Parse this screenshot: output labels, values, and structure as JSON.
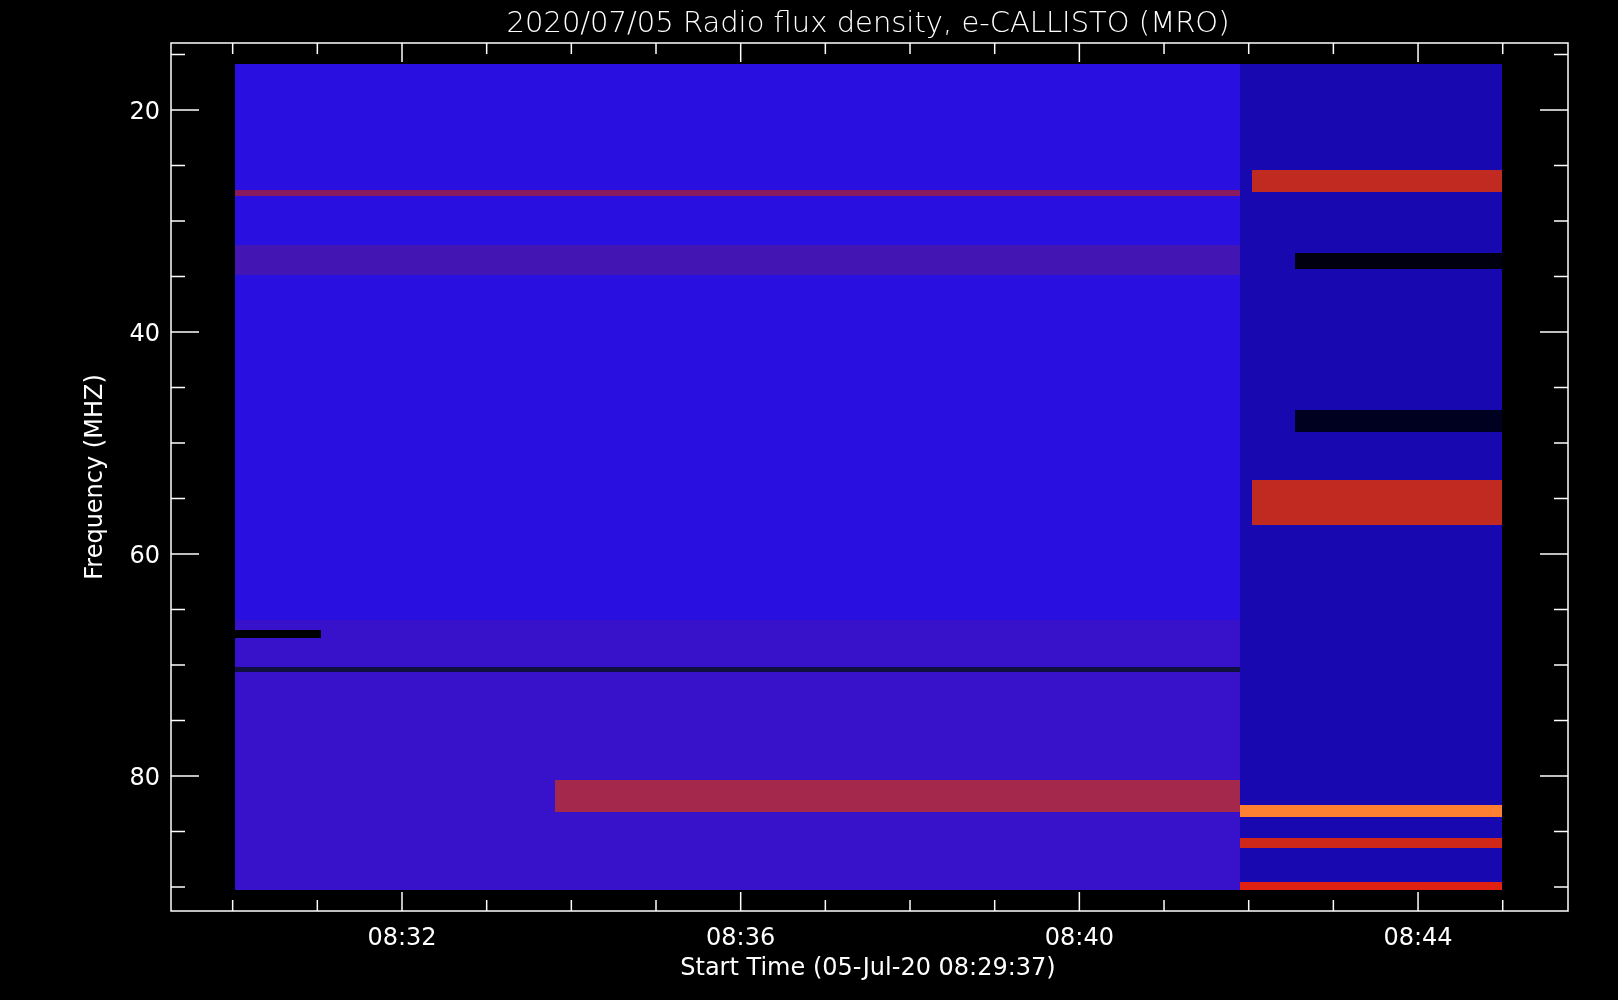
{
  "title": "2020/07/05  Radio flux density, e-CALLISTO (MRO)",
  "y_axis": {
    "label": "Frequency (MHZ)",
    "ticks": [
      "20",
      "40",
      "60",
      "80"
    ]
  },
  "x_axis": {
    "label": "Start Time (05-Jul-20 08:29:37)",
    "ticks": [
      "08:32",
      "08:36",
      "08:40",
      "08:44"
    ]
  }
}
